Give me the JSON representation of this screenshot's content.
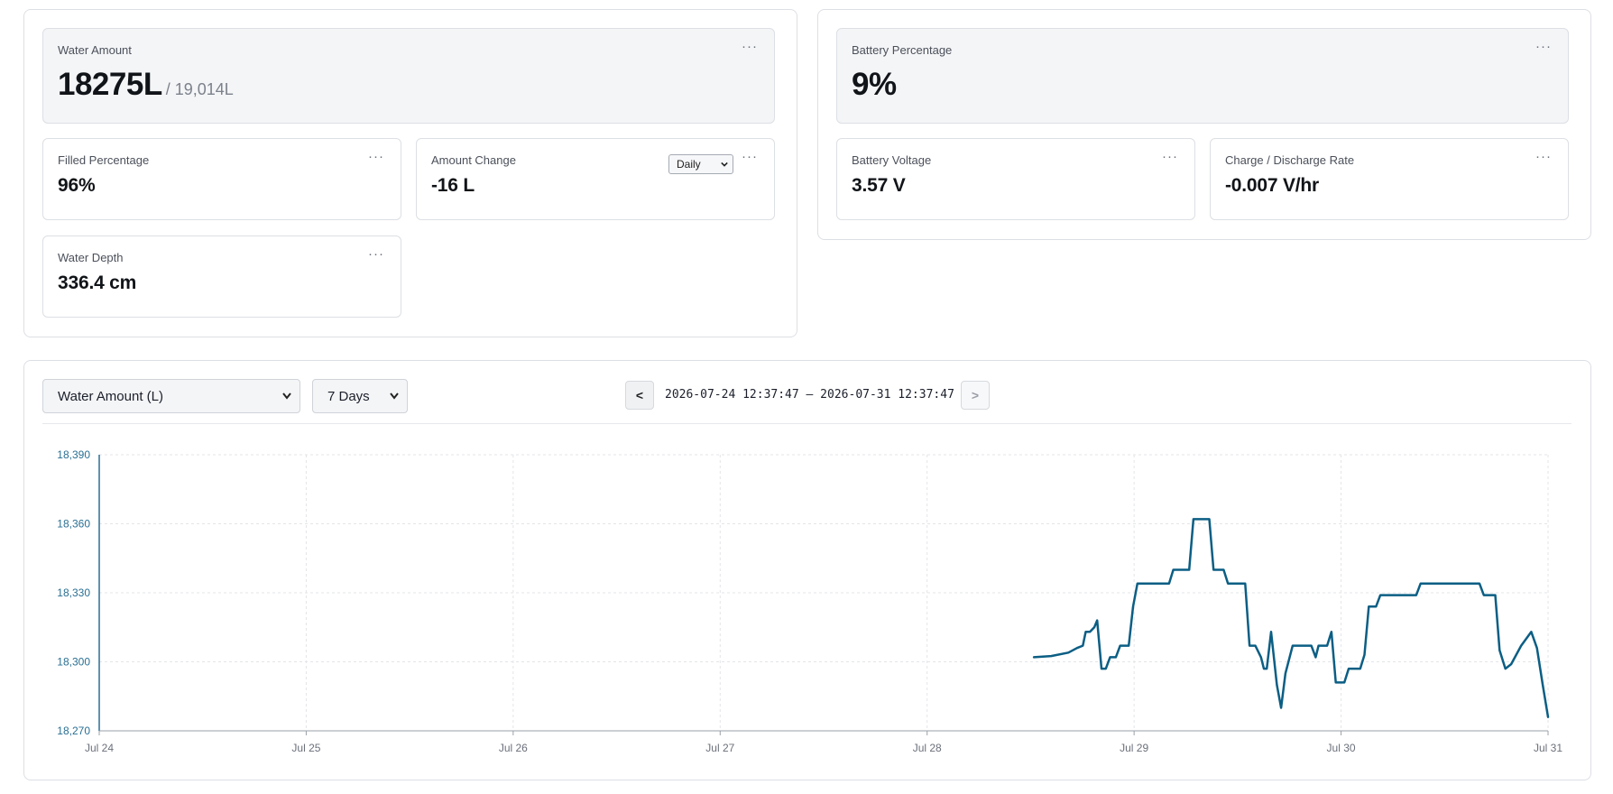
{
  "water_panel": {
    "amount": {
      "title": "Water Amount",
      "value": "18275L",
      "capacity": "/ 19,014L",
      "menu": "···"
    },
    "filled": {
      "title": "Filled Percentage",
      "value": "96%",
      "menu": "···"
    },
    "change": {
      "title": "Amount Change",
      "value": "-16 L",
      "period": "Daily",
      "menu": "···"
    },
    "depth": {
      "title": "Water Depth",
      "value": "336.4 cm",
      "menu": "···"
    }
  },
  "battery_panel": {
    "percentage": {
      "title": "Battery Percentage",
      "value": "9%",
      "menu": "···"
    },
    "voltage": {
      "title": "Battery Voltage",
      "value": "3.57 V",
      "menu": "···"
    },
    "rate": {
      "title": "Charge / Discharge Rate",
      "value": "-0.007 V/hr",
      "menu": "···"
    }
  },
  "chart_controls": {
    "metric": "Water Amount (L)",
    "duration": "7 Days",
    "prev": "<",
    "next": ">",
    "range": "2026-07-24 12:37:47 – 2026-07-31 12:37:47"
  },
  "colors": {
    "line": "#0b5e84",
    "axis": "#2a6f93",
    "grid": "#e3e5e8"
  },
  "chart_data": {
    "type": "line",
    "title": "",
    "xlabel": "",
    "ylabel": "",
    "x_ticks": [
      "Jul 24",
      "Jul 25",
      "Jul 26",
      "Jul 27",
      "Jul 28",
      "Jul 29",
      "Jul 30",
      "Jul 31"
    ],
    "y_ticks": [
      "18,270",
      "18,300",
      "18,330",
      "18,360",
      "18,390"
    ],
    "ylim": [
      18270,
      18390
    ],
    "xlim": [
      "2026-07-24",
      "2026-07-31"
    ],
    "grid": true,
    "series": [
      {
        "values": [
          {
            "x": "2026-07-29 01:00",
            "y": 18302
          },
          {
            "x": "2026-07-29 03:00",
            "y": 18302.5
          },
          {
            "x": "2026-07-29 05:00",
            "y": 18304
          },
          {
            "x": "2026-07-29 06:00",
            "y": 18306
          },
          {
            "x": "2026-07-29 06:40",
            "y": 18307
          },
          {
            "x": "2026-07-29 07:00",
            "y": 18313
          },
          {
            "x": "2026-07-29 07:30",
            "y": 18313
          },
          {
            "x": "2026-07-29 08:00",
            "y": 18315
          },
          {
            "x": "2026-07-29 08:20",
            "y": 18318
          },
          {
            "x": "2026-07-29 08:50",
            "y": 18297
          },
          {
            "x": "2026-07-29 09:20",
            "y": 18297
          },
          {
            "x": "2026-07-29 09:50",
            "y": 18302
          },
          {
            "x": "2026-07-29 10:30",
            "y": 18302
          },
          {
            "x": "2026-07-29 11:00",
            "y": 18307
          },
          {
            "x": "2026-07-29 12:00",
            "y": 18307
          },
          {
            "x": "2026-07-29 12:30",
            "y": 18324
          },
          {
            "x": "2026-07-29 13:00",
            "y": 18334
          },
          {
            "x": "2026-07-29 16:40",
            "y": 18334
          },
          {
            "x": "2026-07-29 17:10",
            "y": 18340
          },
          {
            "x": "2026-07-29 19:00",
            "y": 18340
          },
          {
            "x": "2026-07-29 19:30",
            "y": 18362
          },
          {
            "x": "2026-07-29 21:20",
            "y": 18362
          },
          {
            "x": "2026-07-29 21:50",
            "y": 18340
          },
          {
            "x": "2026-07-29 23:00",
            "y": 18340
          },
          {
            "x": "2026-07-29 23:30",
            "y": 18334
          },
          {
            "x": "2026-07-30 01:30",
            "y": 18334
          },
          {
            "x": "2026-07-30 02:00",
            "y": 18307
          },
          {
            "x": "2026-07-30 02:40",
            "y": 18307
          },
          {
            "x": "2026-07-30 03:20",
            "y": 18302
          },
          {
            "x": "2026-07-30 03:40",
            "y": 18297
          },
          {
            "x": "2026-07-30 04:00",
            "y": 18297
          },
          {
            "x": "2026-07-30 04:30",
            "y": 18313
          },
          {
            "x": "2026-07-30 05:10",
            "y": 18290
          },
          {
            "x": "2026-07-30 05:40",
            "y": 18280
          },
          {
            "x": "2026-07-30 06:10",
            "y": 18295
          },
          {
            "x": "2026-07-30 07:00",
            "y": 18307
          },
          {
            "x": "2026-07-30 09:10",
            "y": 18307
          },
          {
            "x": "2026-07-30 09:40",
            "y": 18302
          },
          {
            "x": "2026-07-30 10:00",
            "y": 18307
          },
          {
            "x": "2026-07-30 11:00",
            "y": 18307
          },
          {
            "x": "2026-07-30 11:30",
            "y": 18313
          },
          {
            "x": "2026-07-30 12:00",
            "y": 18291
          },
          {
            "x": "2026-07-30 13:00",
            "y": 18291
          },
          {
            "x": "2026-07-30 13:30",
            "y": 18297
          },
          {
            "x": "2026-07-30 14:50",
            "y": 18297
          },
          {
            "x": "2026-07-30 15:20",
            "y": 18303
          },
          {
            "x": "2026-07-30 15:50",
            "y": 18324
          },
          {
            "x": "2026-07-30 16:40",
            "y": 18324
          },
          {
            "x": "2026-07-30 17:10",
            "y": 18329
          },
          {
            "x": "2026-07-30 21:20",
            "y": 18329
          },
          {
            "x": "2026-07-30 21:50",
            "y": 18334
          },
          {
            "x": "2026-07-31 04:40",
            "y": 18334
          },
          {
            "x": "2026-07-31 05:10",
            "y": 18329
          },
          {
            "x": "2026-07-31 06:30",
            "y": 18329
          },
          {
            "x": "2026-07-31 07:00",
            "y": 18305
          },
          {
            "x": "2026-07-31 07:40",
            "y": 18297
          },
          {
            "x": "2026-07-31 08:20",
            "y": 18299
          },
          {
            "x": "2026-07-31 09:30",
            "y": 18307
          },
          {
            "x": "2026-07-31 10:40",
            "y": 18313
          },
          {
            "x": "2026-07-31 11:20",
            "y": 18306
          },
          {
            "x": "2026-07-31 12:00",
            "y": 18290
          },
          {
            "x": "2026-07-31 12:37",
            "y": 18276
          }
        ]
      }
    ]
  }
}
